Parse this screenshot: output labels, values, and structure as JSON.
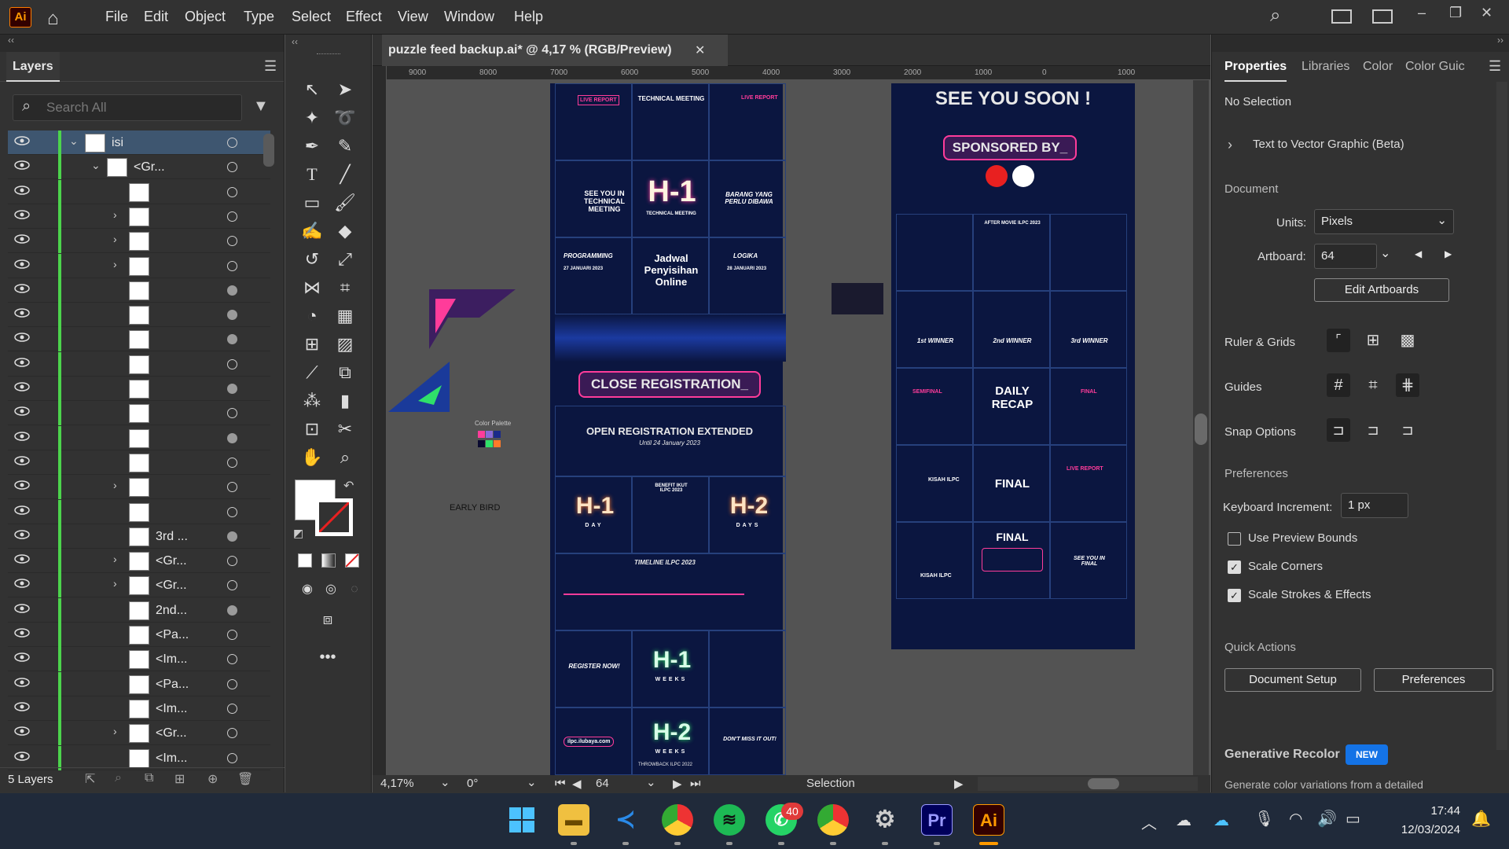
{
  "menubar": {
    "logo": "Ai",
    "items": [
      "File",
      "Edit",
      "Object",
      "Type",
      "Select",
      "Effect",
      "View",
      "Window",
      "Help"
    ]
  },
  "layers_panel": {
    "tab": "Layers",
    "search_placeholder": "Search All",
    "rows": [
      {
        "name": "isi",
        "expand": "down",
        "selected": true
      },
      {
        "name": "<Gr...",
        "expand": "down"
      },
      {
        "name": ""
      },
      {
        "name": "",
        "expand": "right"
      },
      {
        "name": "",
        "expand": "right"
      },
      {
        "name": "",
        "expand": "right"
      },
      {
        "name": ""
      },
      {
        "name": ""
      },
      {
        "name": ""
      },
      {
        "name": ""
      },
      {
        "name": ""
      },
      {
        "name": ""
      },
      {
        "name": ""
      },
      {
        "name": ""
      },
      {
        "name": "",
        "expand": "right"
      },
      {
        "name": ""
      },
      {
        "name": "3rd ..."
      },
      {
        "name": "<Gr...",
        "expand": "right"
      },
      {
        "name": "<Gr...",
        "expand": "right"
      },
      {
        "name": "2nd..."
      },
      {
        "name": "<Pa..."
      },
      {
        "name": "<Im..."
      },
      {
        "name": "<Pa..."
      },
      {
        "name": "<Im..."
      },
      {
        "name": "<Gr...",
        "expand": "right"
      },
      {
        "name": "<Im..."
      }
    ],
    "footer": "5 Layers"
  },
  "document": {
    "tab_title": "puzzle feed backup.ai* @ 4,17 % (RGB/Preview)",
    "ruler_labels": [
      "9000",
      "8000",
      "7000",
      "6000",
      "5000",
      "4000",
      "3000",
      "2000",
      "1000",
      "0",
      "1000"
    ],
    "canvas_labels": {
      "color_palette": "Color Palette",
      "early_bird": "EARLY BIRD"
    },
    "left_board": {
      "live_report": "LIVE REPORT",
      "technical_meeting": "TECHNICAL MEETING",
      "h1_tm": "H-1",
      "h1_tm_sub": "TECHNICAL MEETING",
      "see_tm": "SEE YOU IN TECHNICAL MEETING",
      "barang": "BARANG YANG PERLU DIBAWA",
      "programming": "PROGRAMMING",
      "programming_date": "27 JANUARI 2023",
      "jadwal": "Jadwal Penyisihan Online",
      "logika": "LOGIKA",
      "logika_date": "28 JANUARI 2023",
      "close_reg": "CLOSE REGISTRATION_",
      "open_reg": "OPEN REGISTRATION EXTENDED",
      "open_reg_sub": "Until 24 January 2023",
      "h1_day": "H-1",
      "h1_day_sub": "DAY",
      "benefit": "BENEFIT IKUT ILPC 2023",
      "h2_days": "H-2",
      "h2_days_sub": "DAYS",
      "timeline": "TIMELINE ILPC 2023",
      "register": "REGISTER NOW!",
      "h1_weeks": "H-1",
      "h1_weeks_sub": "WEEKS",
      "site": "ilpc.ilubaya.com",
      "h2_weeks": "H-2",
      "h2_weeks_sub": "WEEKS",
      "dont_miss": "DON'T MISS IT OUT!",
      "throwback": "THROWBACK ILPC 2022"
    },
    "right_board": {
      "see_you": "SEE YOU SOON !",
      "sponsored": "SPONSORED BY_",
      "after_movie": "AFTER MOVIE ILPC 2023",
      "first": "1st WINNER",
      "second": "2nd WINNER",
      "third": "3rd WINNER",
      "semifinal": "SEMIFINAL",
      "daily_recap": "DAILY RECAP",
      "final_tag": "FINAL",
      "kisah1": "KISAH ILPC",
      "final_big": "FINAL",
      "live_report": "LIVE REPORT",
      "kisah2": "KISAH ILPC",
      "final_box": "FINAL",
      "see_final": "SEE YOU IN FINAL"
    },
    "status": {
      "zoom": "4,17%",
      "rotation": "0°",
      "artboard": "64",
      "tool": "Selection"
    }
  },
  "properties_panel": {
    "tabs": [
      "Properties",
      "Libraries",
      "Color",
      "Color Guic"
    ],
    "no_selection": "No Selection",
    "text_to_vector": "Text to Vector Graphic (Beta)",
    "document_label": "Document",
    "units_label": "Units:",
    "units_value": "Pixels",
    "artboard_label": "Artboard:",
    "artboard_value": "64",
    "edit_artboards": "Edit Artboards",
    "ruler_grids": "Ruler & Grids",
    "guides": "Guides",
    "snap_options": "Snap Options",
    "preferences_label": "Preferences",
    "keyboard_increment_label": "Keyboard Increment:",
    "keyboard_increment_value": "1 px",
    "use_preview_bounds": "Use Preview Bounds",
    "scale_corners": "Scale Corners",
    "scale_strokes": "Scale Strokes & Effects",
    "checkbox_states": {
      "use_preview_bounds": false,
      "scale_corners": true,
      "scale_strokes": true
    },
    "quick_actions": "Quick Actions",
    "document_setup": "Document Setup",
    "preferences_button": "Preferences",
    "generative_recolor": "Generative Recolor",
    "new_badge": "NEW",
    "recolor_desc": "Generate color variations from a detailed"
  },
  "taskbar": {
    "whatsapp_badge": "40",
    "time": "17:44",
    "date": "12/03/2024"
  },
  "colors": {
    "accent_pink": "#ff3c9a",
    "accent_cyan": "#2fd6ff",
    "artboard_bg": "#0b1640",
    "selection_bg": "#3e5670"
  }
}
